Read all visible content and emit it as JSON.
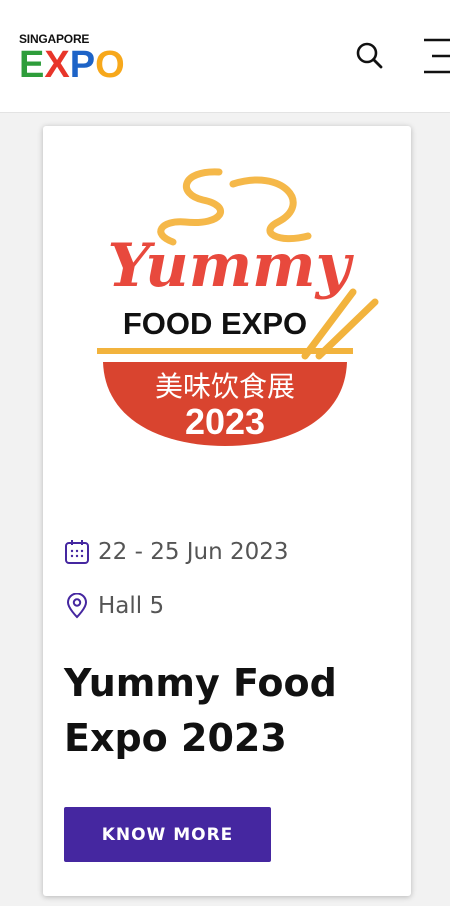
{
  "header": {
    "logo_small_text": "SINGAPORE",
    "logo_letters": [
      "E",
      "X",
      "P",
      "O"
    ],
    "logo_colors": [
      "#2e9d3b",
      "#e8352a",
      "#1d63c7",
      "#f7a81b"
    ],
    "search_icon": "search-icon",
    "menu_icon": "hamburger-menu-icon"
  },
  "event": {
    "logo": {
      "word": "Yummy",
      "line2": "FOOD EXPO",
      "chinese": "美味饮食展",
      "year": "2023",
      "colors": {
        "steam": "#f5b849",
        "yummy": "#e8493d",
        "bowl": "#d9442f",
        "chopsticks": "#f2b33d",
        "text_dark": "#111111"
      }
    },
    "date_icon": "calendar-icon",
    "date": "22 - 25 Jun 2023",
    "location_icon": "location-pin-icon",
    "location": "Hall 5",
    "title": "Yummy Food Expo 2023",
    "cta_label": "KNOW MORE",
    "accent_color": "#4527a0"
  }
}
